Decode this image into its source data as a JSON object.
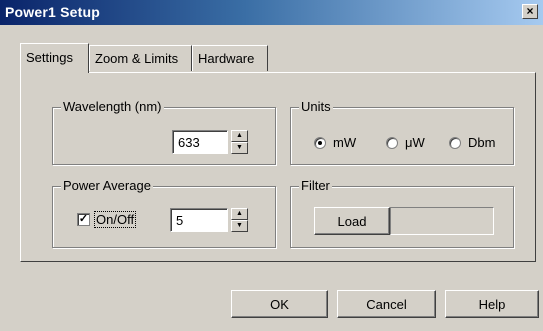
{
  "window": {
    "title": "Power1 Setup",
    "close_symbol": "×"
  },
  "tabs": [
    {
      "label": "Settings",
      "active": true
    },
    {
      "label": "Zoom & Limits",
      "active": false
    },
    {
      "label": "Hardware",
      "active": false
    }
  ],
  "wavelength": {
    "legend": "Wavelength (nm)",
    "value": "633"
  },
  "units": {
    "legend": "Units",
    "options": [
      {
        "label": "mW",
        "selected": true
      },
      {
        "label": "μW",
        "selected": false
      },
      {
        "label": "Dbm",
        "selected": false
      }
    ]
  },
  "power_average": {
    "legend": "Power Average",
    "toggle_label": "On/Off",
    "checked": true,
    "check_symbol": "✓",
    "value": "5"
  },
  "filter": {
    "legend": "Filter",
    "load_label": "Load",
    "value": ""
  },
  "buttons": {
    "ok": "OK",
    "cancel": "Cancel",
    "help": "Help"
  },
  "icons": {
    "spin_up": "up-arrow-icon",
    "spin_down": "down-arrow-icon",
    "up_glyph": "▲",
    "down_glyph": "▼"
  },
  "colors": {
    "dialog_bg": "#d4d0c8",
    "title_start": "#0a246a",
    "title_end": "#a6caf0"
  }
}
